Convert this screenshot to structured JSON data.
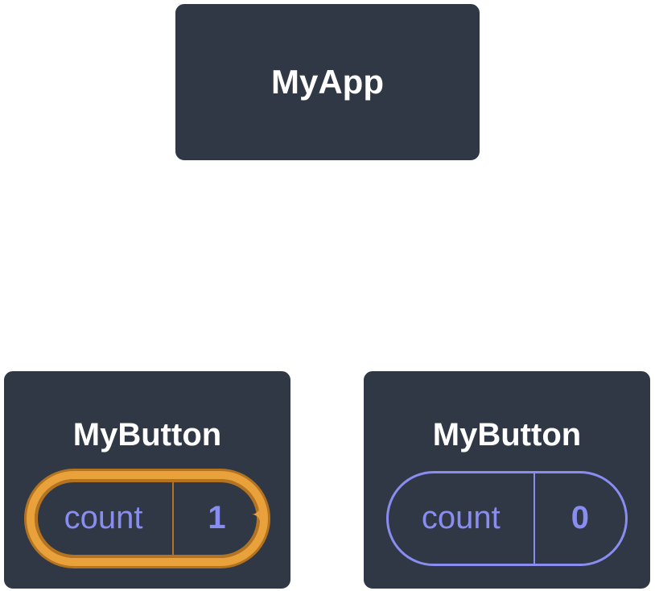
{
  "tree": {
    "root": {
      "label": "MyApp"
    },
    "children": [
      {
        "label": "MyButton",
        "state": {
          "key": "count",
          "value": "1"
        },
        "highlighted": true
      },
      {
        "label": "MyButton",
        "state": {
          "key": "count",
          "value": "0"
        },
        "highlighted": false
      }
    ]
  }
}
